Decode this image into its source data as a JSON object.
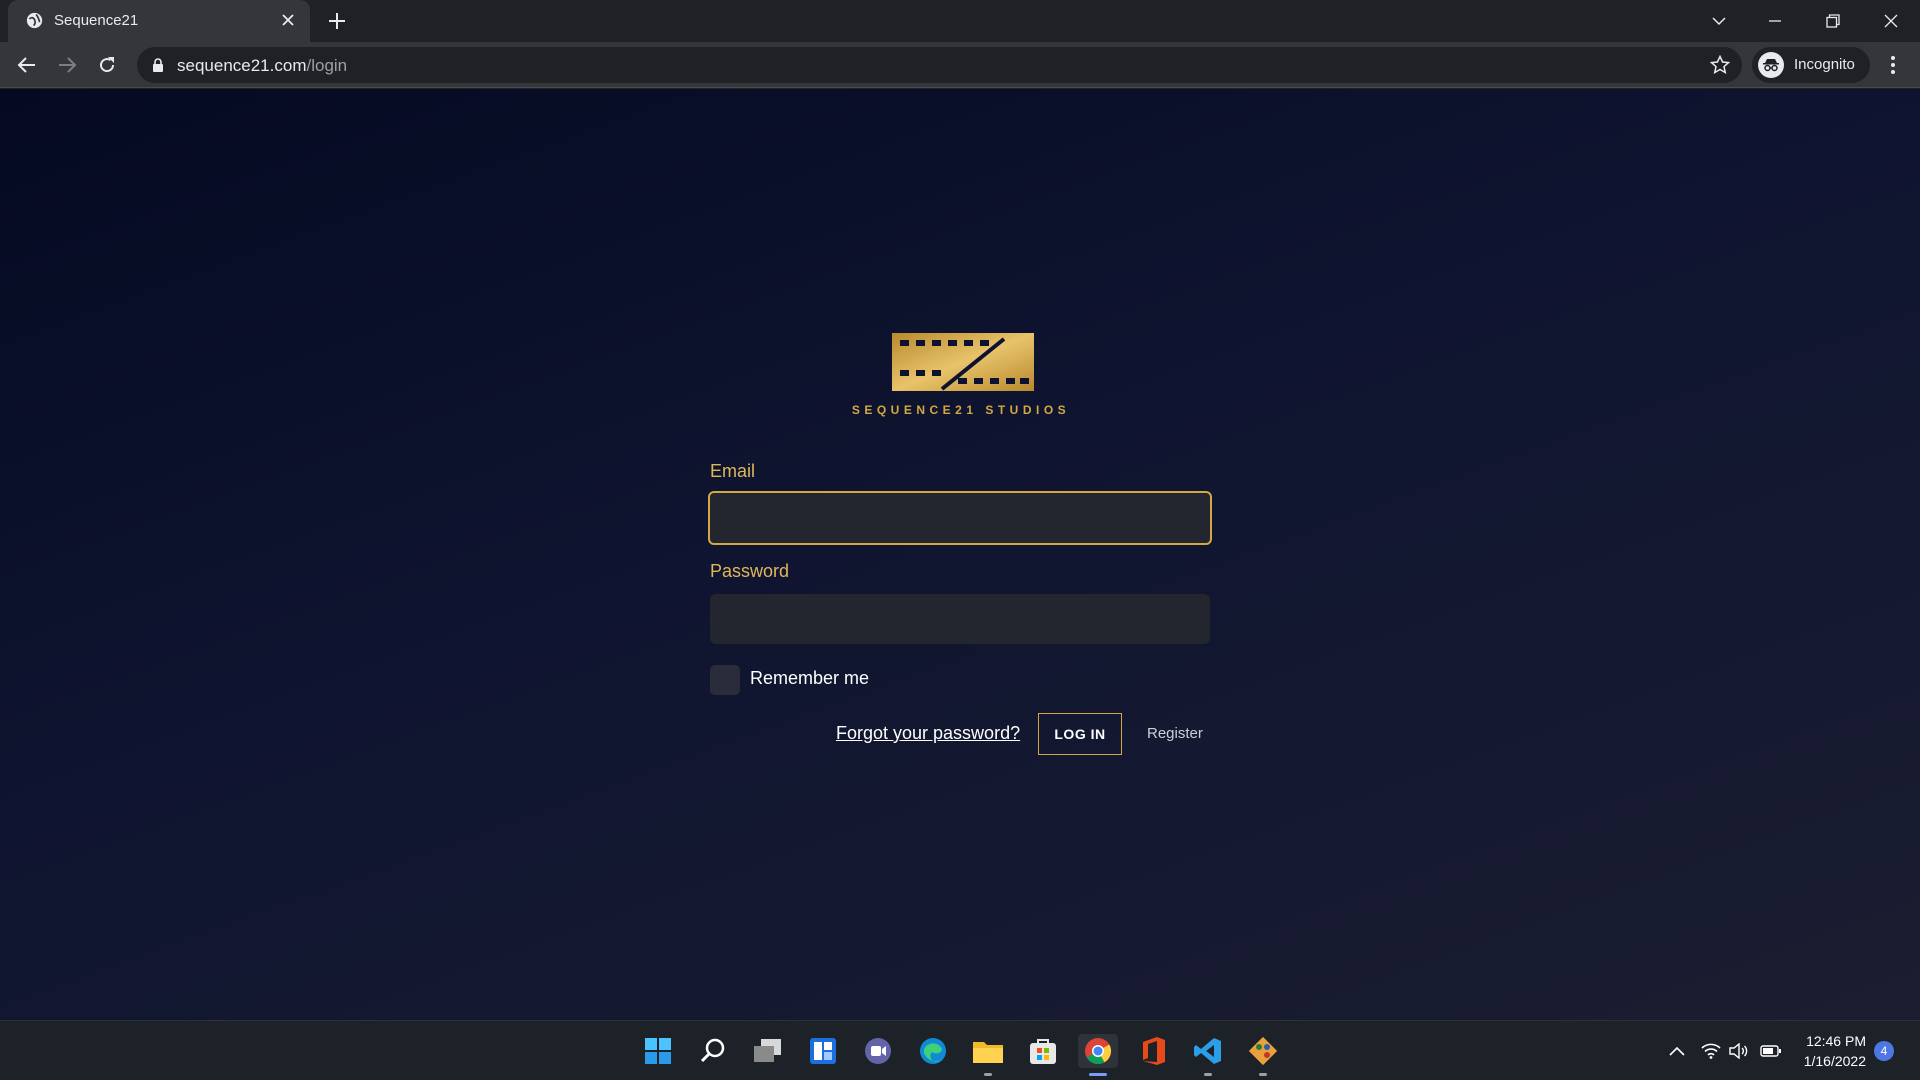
{
  "browser": {
    "tab_title": "Sequence21",
    "url_host": "sequence21.com",
    "url_path": "/login",
    "profile_label": "Incognito"
  },
  "page": {
    "brand": "SEQUENCE21 STUDIOS",
    "email_label": "Email",
    "email_value": "",
    "password_label": "Password",
    "password_value": "",
    "remember_label": "Remember me",
    "forgot_link": "Forgot your password?",
    "login_button": "LOG IN",
    "register_link": "Register"
  },
  "taskbar": {
    "time": "12:46 PM",
    "date": "1/16/2022",
    "notification_count": "4"
  },
  "colors": {
    "accent_gold": "#d4a745",
    "page_bg_top": "#050a22",
    "page_bg_bottom": "#1b1e30",
    "chrome_bg": "#35363a"
  },
  "icons": [
    "globe-icon",
    "close-icon",
    "plus-icon",
    "back-icon",
    "forward-icon",
    "reload-icon",
    "lock-icon",
    "star-icon",
    "incognito-icon",
    "more-icon",
    "windows-start-icon",
    "search-icon",
    "task-view-icon",
    "widgets-icon",
    "chat-icon",
    "edge-icon",
    "file-explorer-icon",
    "store-icon",
    "chrome-icon",
    "office-icon",
    "vscode-icon",
    "git-icon",
    "chevron-up-icon",
    "wifi-icon",
    "volume-icon",
    "battery-icon"
  ]
}
